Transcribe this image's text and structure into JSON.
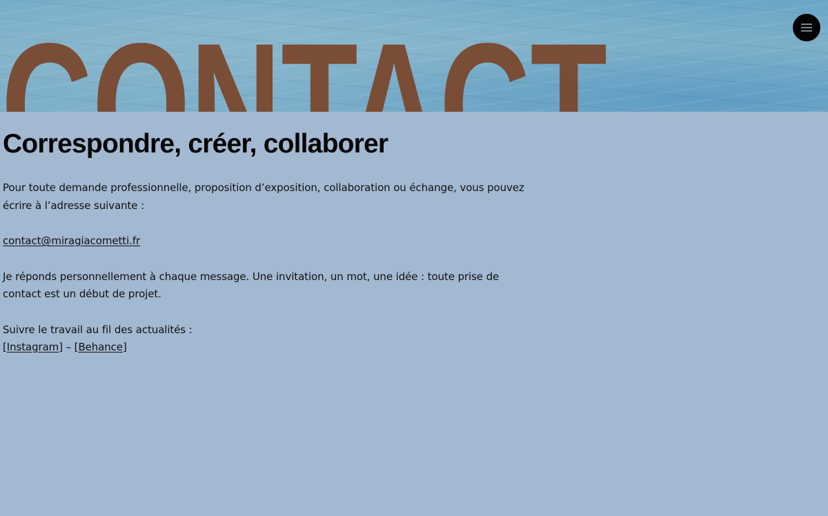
{
  "hero": {
    "word": "CONTACT",
    "word_color": "#7a4a32",
    "background_color": "#7eb0ca"
  },
  "menu": {
    "icon": "hamburger-menu-icon",
    "background": "#050505"
  },
  "main": {
    "title": "Correspondre, créer, collaborer",
    "intro_line1": "Pour toute demande professionnelle, proposition d’exposition, collaboration ou échange, vous pouvez",
    "intro_line2": "écrire à l’adresse suivante :",
    "email": "contact@miragiacometti.fr",
    "reply_line1": "Je réponds personnellement à chaque message. Une invitation, un mot, une idée : toute prise de",
    "reply_line2": "contact est un début de projet.",
    "follow_text": "Suivre le travail au fil des actualités :",
    "bracket_open_1": "[",
    "instagram_label": "Instagram",
    "separator": "] – [",
    "behance_label": "Behance",
    "bracket_close_2": "]"
  },
  "colors": {
    "page_background": "#a3b8d1",
    "text": "#111111"
  }
}
